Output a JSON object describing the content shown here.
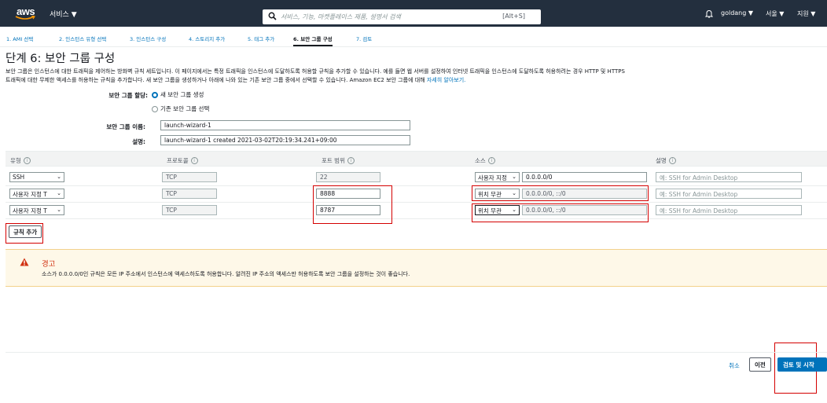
{
  "topnav": {
    "logo_text": "aws",
    "services_label": "서비스 ▼",
    "search_placeholder": "서비스, 기능, 마켓플레이스 제품, 설명서 검색",
    "search_shortcut": "[Alt+S]",
    "user_label": "goldang ▼",
    "region_label": "서울 ▼",
    "support_label": "지원 ▼"
  },
  "steps": [
    {
      "label": "1. AMI 선택"
    },
    {
      "label": "2. 인스턴스 유형 선택"
    },
    {
      "label": "3. 인스턴스 구성"
    },
    {
      "label": "4. 스토리지 추가"
    },
    {
      "label": "5. 태그 추가"
    },
    {
      "label": "6. 보안 그룹 구성"
    },
    {
      "label": "7. 검토"
    }
  ],
  "page": {
    "title": "단계 6: 보안 그룹 구성",
    "desc_line1": "보안 그룹은 인스턴스에 대한 트래픽을 제어하는 방화벽 규칙 세트입니다. 이 페이지에서는 특정 트래픽을 인스턴스에 도달하도록 허용할 규칙을 추가할 수 있습니다. 예를 들면 웹 서버를 설정하여 인터넷 트래픽을 인스턴스에 도달하도록 허용하려는 경우 HTTP 및 HTTPS",
    "desc_line2": "트래픽에 대한 무제한 액세스를 허용하는 규칙을 추가합니다. 새 보안 그룹을 생성하거나 아래에 나와 있는 기존 보안 그룹 중에서 선택할 수 있습니다. Amazon EC2 보안 그룹에 대해",
    "desc_link": "자세히 알아보기."
  },
  "form": {
    "assign_label": "보안 그룹 할당:",
    "radio_new": "새 보안 그룹 생성",
    "radio_existing": "기존 보안 그룹 선택",
    "name_label": "보안 그룹 이름:",
    "name_value": "launch-wizard-1",
    "desc_label": "설명:",
    "desc_value": "launch-wizard-1 created 2021-03-02T20:19:34.241+09:00"
  },
  "table": {
    "headers": [
      "유형",
      "프로토콜",
      "포트 범위",
      "소스",
      "설명"
    ],
    "info_glyph": "i",
    "rows": [
      {
        "type": "SSH",
        "protocol": "TCP",
        "port": "22",
        "source": "사용자 지정",
        "cidr": "0.0.0.0/0",
        "desc_placeholder": "예: SSH for Admin Desktop"
      },
      {
        "type": "사용자 지정 T",
        "protocol": "TCP",
        "port": "8888",
        "source": "위치 무관",
        "cidr": "0.0.0.0/0, ::/0",
        "desc_placeholder": "예: SSH for Admin Desktop"
      },
      {
        "type": "사용자 지정 T",
        "protocol": "TCP",
        "port": "8787",
        "source": "위치 무관",
        "cidr": "0.0.0.0/0, ::/0",
        "desc_placeholder": "예: SSH for Admin Desktop"
      }
    ]
  },
  "add_rule_label": "규칙 추가",
  "warning": {
    "title": "경고",
    "text": "소스가 0.0.0.0/0인 규칙은 모든 IP 주소에서 인스턴스에 액세스하도록 허용합니다. 알려진 IP 주소의 액세스만 허용하도록 보안 그룹을 설정하는 것이 좋습니다."
  },
  "footer": {
    "cancel": "취소",
    "previous": "이전",
    "review": "검토 및 시작"
  },
  "colors": {
    "accent": "#0073bb",
    "nav_bg": "#232f3e",
    "highlight": "#d40000",
    "warning": "#d13212"
  }
}
